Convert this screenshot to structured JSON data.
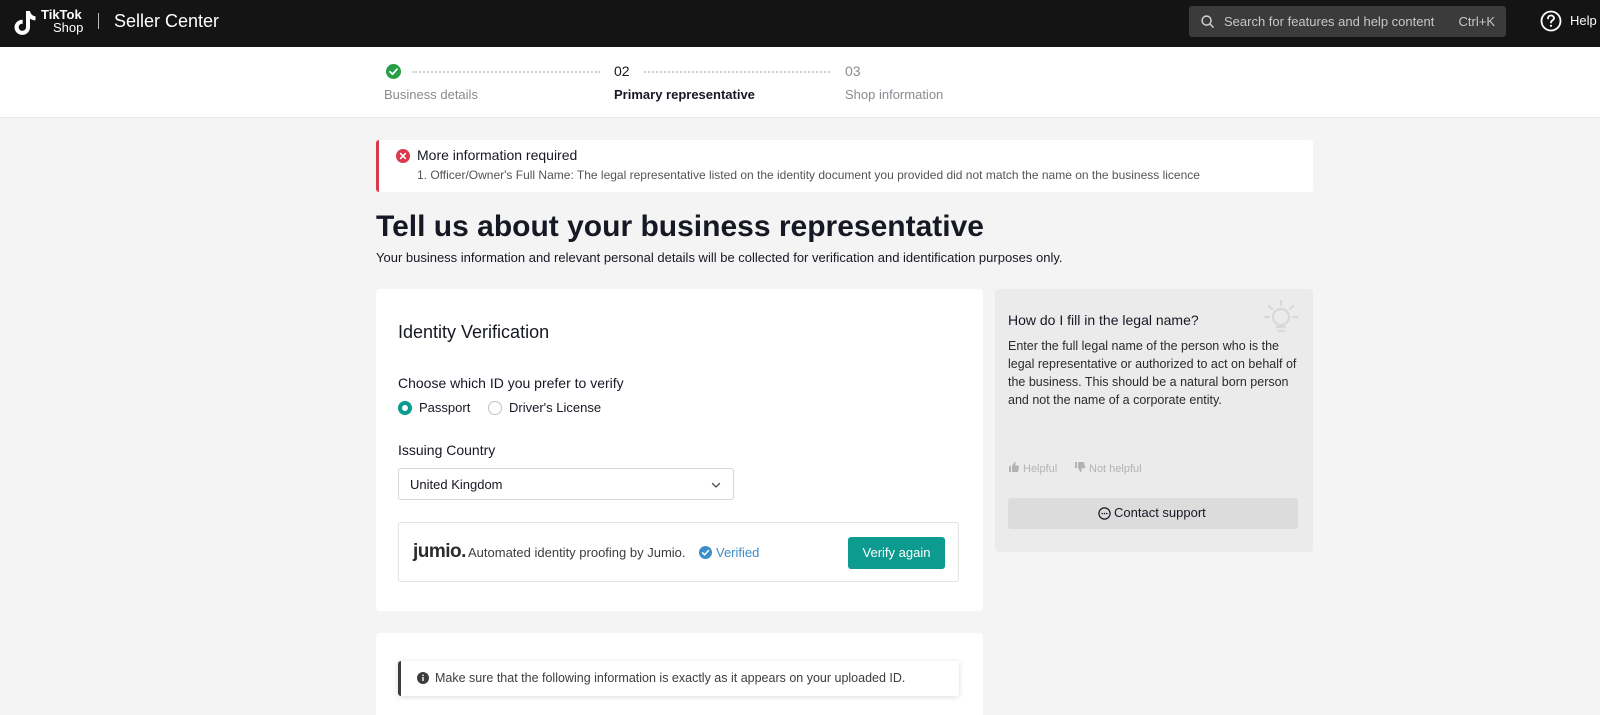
{
  "header": {
    "logo_line1": "TikTok",
    "logo_line2": "Shop",
    "app_title": "Seller Center",
    "search_placeholder": "Search for features and help content",
    "search_shortcut": "Ctrl+K",
    "help_label": "Help"
  },
  "stepper": {
    "steps": [
      {
        "number": "",
        "label": "Business details",
        "state": "completed"
      },
      {
        "number": "02",
        "label": "Primary representative",
        "state": "active"
      },
      {
        "number": "03",
        "label": "Shop information",
        "state": "upcoming"
      }
    ]
  },
  "alert": {
    "title": "More information required",
    "message": "1. Officer/Owner's Full Name: The legal representative listed on the identity document you provided did not match the name on the business licence"
  },
  "page": {
    "title": "Tell us about your business representative",
    "subtitle": "Your business information and relevant personal details will be collected for verification and identification purposes only."
  },
  "identity": {
    "card_title": "Identity Verification",
    "id_question": "Choose which ID you prefer to verify",
    "options": [
      {
        "label": "Passport",
        "checked": true
      },
      {
        "label": "Driver's License",
        "checked": false
      }
    ],
    "country_label": "Issuing Country",
    "country_value": "United Kingdom",
    "jumio_logo": "jumio.",
    "jumio_text": "Automated identity proofing by Jumio.",
    "verified_text": "Verified",
    "verify_button": "Verify again"
  },
  "help_panel": {
    "title": "How do I fill in the legal name?",
    "body": "Enter the full legal name of the person who is the legal representative or authorized to act on behalf of the business. This should be a natural born person and not the name of a corporate entity.",
    "helpful": "Helpful",
    "not_helpful": "Not helpful",
    "contact_button": "Contact support"
  },
  "notice": {
    "text": "Make sure that the following information is exactly as it appears on your uploaded ID."
  },
  "colors": {
    "accent": "#0c9b8e",
    "error": "#d9384d",
    "topbar": "#141414",
    "verified": "#3a8fc9",
    "success": "#25a046"
  }
}
